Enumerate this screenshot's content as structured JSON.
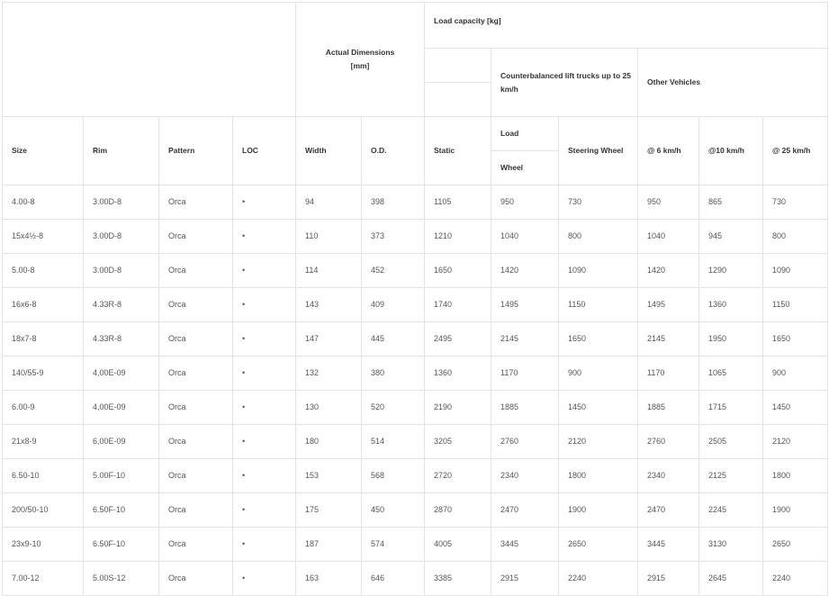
{
  "header": {
    "actual_dimensions": "Actual Dimensions",
    "actual_dimensions_unit": "[mm]",
    "load_capacity": "Load capacity [kg]",
    "counterbalanced": "Counterbalanced lift trucks up to 25 km/h",
    "other_vehicles": "Other Vehicles",
    "load": "Load",
    "wheel": "Wheel",
    "columns": {
      "size": "Size",
      "rim": "Rim",
      "pattern": "Pattern",
      "loc": "LOC",
      "width": "Width",
      "od": "O.D.",
      "static": "Static",
      "steering_wheel": "Steering Wheel",
      "at6": "@ 6 km/h",
      "at10": "@10 km/h",
      "at25": "@ 25 km/h"
    }
  },
  "rows": [
    {
      "size": "4.00-8",
      "rim": "3.00D-8",
      "pattern": "Orca",
      "loc": "•",
      "width": "94",
      "od": "398",
      "static": "1105",
      "load_wheel": "950",
      "steering": "730",
      "at6": "950",
      "at10": "865",
      "at25": "730"
    },
    {
      "size": "15x4½-8",
      "rim": "3.00D-8",
      "pattern": "Orca",
      "loc": "•",
      "width": "110",
      "od": "373",
      "static": "1210",
      "load_wheel": "1040",
      "steering": "800",
      "at6": "1040",
      "at10": "945",
      "at25": "800"
    },
    {
      "size": "5.00-8",
      "rim": "3.00D-8",
      "pattern": "Orca",
      "loc": "•",
      "width": "114",
      "od": "452",
      "static": "1650",
      "load_wheel": "1420",
      "steering": "1090",
      "at6": "1420",
      "at10": "1290",
      "at25": "1090"
    },
    {
      "size": "16x6-8",
      "rim": "4.33R-8",
      "pattern": "Orca",
      "loc": "•",
      "width": "143",
      "od": "409",
      "static": "1740",
      "load_wheel": "1495",
      "steering": "1150",
      "at6": "1495",
      "at10": "1360",
      "at25": "1150"
    },
    {
      "size": "18x7-8",
      "rim": "4.33R-8",
      "pattern": "Orca",
      "loc": "•",
      "width": "147",
      "od": "445",
      "static": "2495",
      "load_wheel": "2145",
      "steering": "1650",
      "at6": "2145",
      "at10": "1950",
      "at25": "1650"
    },
    {
      "size": "140/55-9",
      "rim": "4,00E-09",
      "pattern": "Orca",
      "loc": "•",
      "width": "132",
      "od": "380",
      "static": "1360",
      "load_wheel": "1170",
      "steering": "900",
      "at6": "1170",
      "at10": "1065",
      "at25": "900"
    },
    {
      "size": "6.00-9",
      "rim": "4,00E-09",
      "pattern": "Orca",
      "loc": "•",
      "width": "130",
      "od": "520",
      "static": "2190",
      "load_wheel": "1885",
      "steering": "1450",
      "at6": "1885",
      "at10": "1715",
      "at25": "1450"
    },
    {
      "size": "21x8-9",
      "rim": "6,00E-09",
      "pattern": "Orca",
      "loc": "•",
      "width": "180",
      "od": "514",
      "static": "3205",
      "load_wheel": "2760",
      "steering": "2120",
      "at6": "2760",
      "at10": "2505",
      "at25": "2120"
    },
    {
      "size": "6.50-10",
      "rim": "5.00F-10",
      "pattern": "Orca",
      "loc": "•",
      "width": "153",
      "od": "568",
      "static": "2720",
      "load_wheel": "2340",
      "steering": "1800",
      "at6": "2340",
      "at10": "2125",
      "at25": "1800"
    },
    {
      "size": "200/50-10",
      "rim": "6.50F-10",
      "pattern": "Orca",
      "loc": "•",
      "width": "175",
      "od": "450",
      "static": "2870",
      "load_wheel": "2470",
      "steering": "1900",
      "at6": "2470",
      "at10": "2245",
      "at25": "1900"
    },
    {
      "size": "23x9-10",
      "rim": "6.50F-10",
      "pattern": "Orca",
      "loc": "•",
      "width": "187",
      "od": "574",
      "static": "4005",
      "load_wheel": "3445",
      "steering": "2650",
      "at6": "3445",
      "at10": "3130",
      "at25": "2650"
    },
    {
      "size": "7.00-12",
      "rim": "5.00S-12",
      "pattern": "Orca",
      "loc": "•",
      "width": "163",
      "od": "646",
      "static": "3385",
      "load_wheel": "2915",
      "steering": "2240",
      "at6": "2915",
      "at10": "2645",
      "at25": "2240"
    }
  ]
}
